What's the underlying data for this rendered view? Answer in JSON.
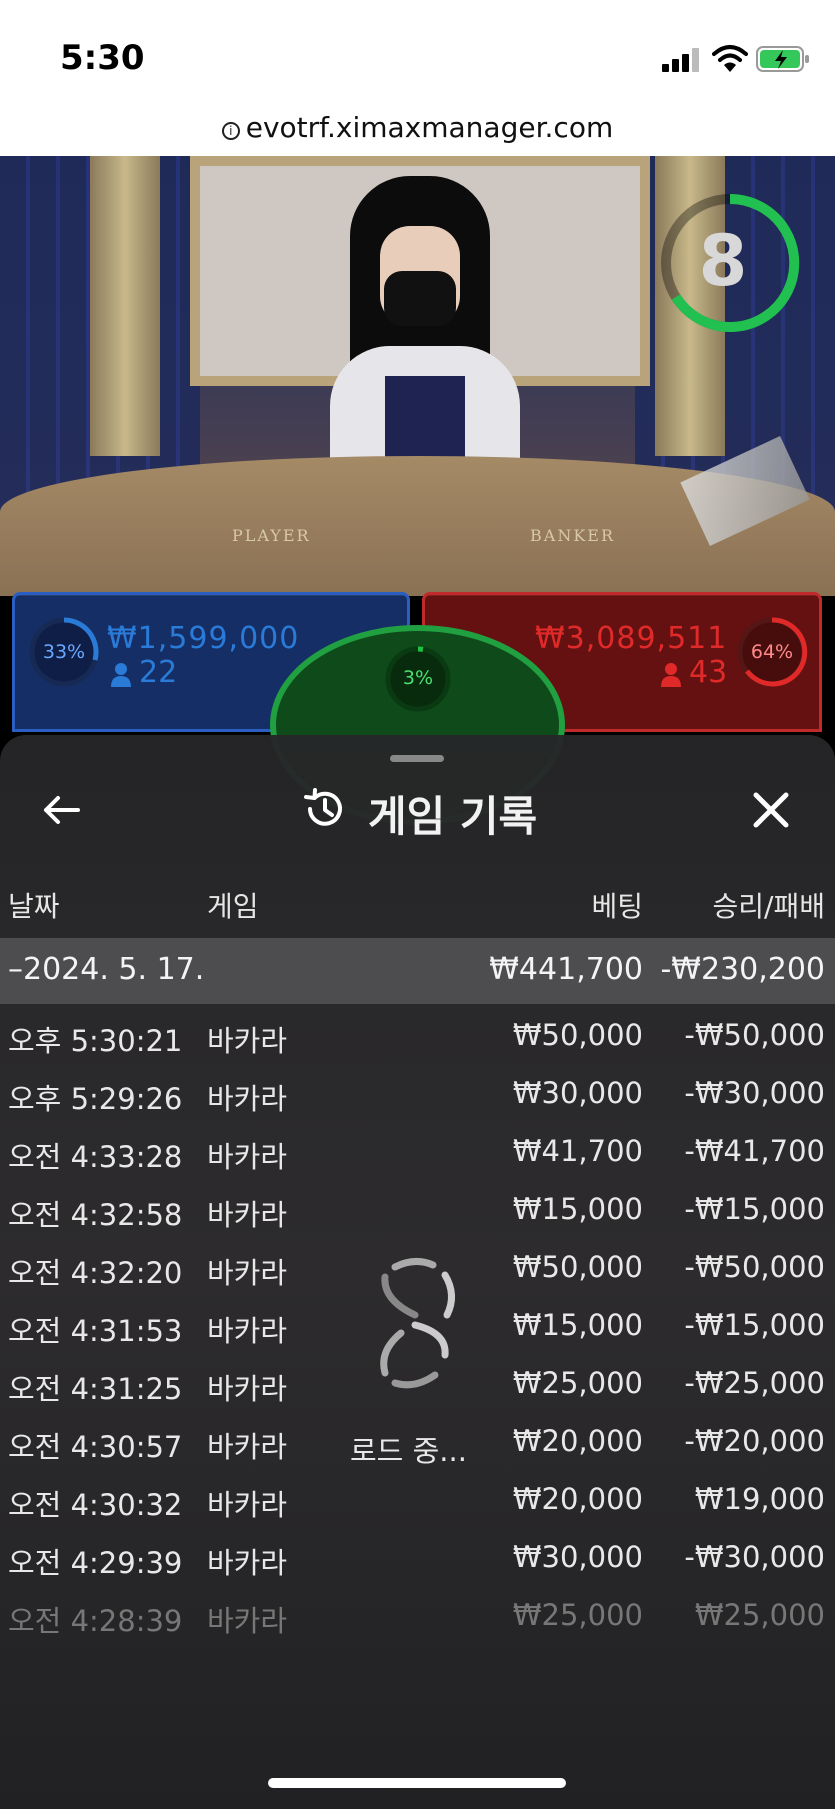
{
  "status_bar": {
    "time": "5:30"
  },
  "browser": {
    "url": "evotrf.ximaxmanager.com"
  },
  "table_timer": {
    "value": "8"
  },
  "bets": {
    "player": {
      "percent": "33%",
      "amount": "₩1,599,000",
      "players": "22"
    },
    "tie": {
      "percent": "3%"
    },
    "banker": {
      "percent": "64%",
      "amount": "₩3,089,511",
      "players": "43"
    }
  },
  "table_labels": {
    "player": "PLAYER",
    "banker": "BANKER"
  },
  "sheet": {
    "title": "게임 기록",
    "columns": {
      "date": "날짜",
      "game": "게임",
      "bet": "베팅",
      "result": "승리/패배"
    },
    "date_group": {
      "date": "–2024. 5. 17.",
      "bet_total": "₩441,700",
      "result_total": "-₩230,200"
    },
    "rows": [
      {
        "time": "오후 5:30:21",
        "game": "바카라",
        "bet": "₩50,000",
        "result": "-₩50,000"
      },
      {
        "time": "오후 5:29:26",
        "game": "바카라",
        "bet": "₩30,000",
        "result": "-₩30,000"
      },
      {
        "time": "오전 4:33:28",
        "game": "바카라",
        "bet": "₩41,700",
        "result": "-₩41,700"
      },
      {
        "time": "오전 4:32:58",
        "game": "바카라",
        "bet": "₩15,000",
        "result": "-₩15,000"
      },
      {
        "time": "오전 4:32:20",
        "game": "바카라",
        "bet": "₩50,000",
        "result": "-₩50,000"
      },
      {
        "time": "오전 4:31:53",
        "game": "바카라",
        "bet": "₩15,000",
        "result": "-₩15,000"
      },
      {
        "time": "오전 4:31:25",
        "game": "바카라",
        "bet": "₩25,000",
        "result": "-₩25,000"
      },
      {
        "time": "오전 4:30:57",
        "game": "바카라",
        "bet": "₩20,000",
        "result": "-₩20,000"
      },
      {
        "time": "오전 4:30:32",
        "game": "바카라",
        "bet": "₩20,000",
        "result": "₩19,000"
      },
      {
        "time": "오전 4:29:39",
        "game": "바카라",
        "bet": "₩30,000",
        "result": "-₩30,000"
      },
      {
        "time": "오전 4:28:39",
        "game": "바카라",
        "bet": "₩25,000",
        "result": "₩25,000"
      }
    ],
    "loading": "로드 중..."
  },
  "colors": {
    "player_blue": "#2a7ad8",
    "banker_red": "#e02a2a",
    "tie_green": "#20c040",
    "timer_green": "#22c050"
  }
}
